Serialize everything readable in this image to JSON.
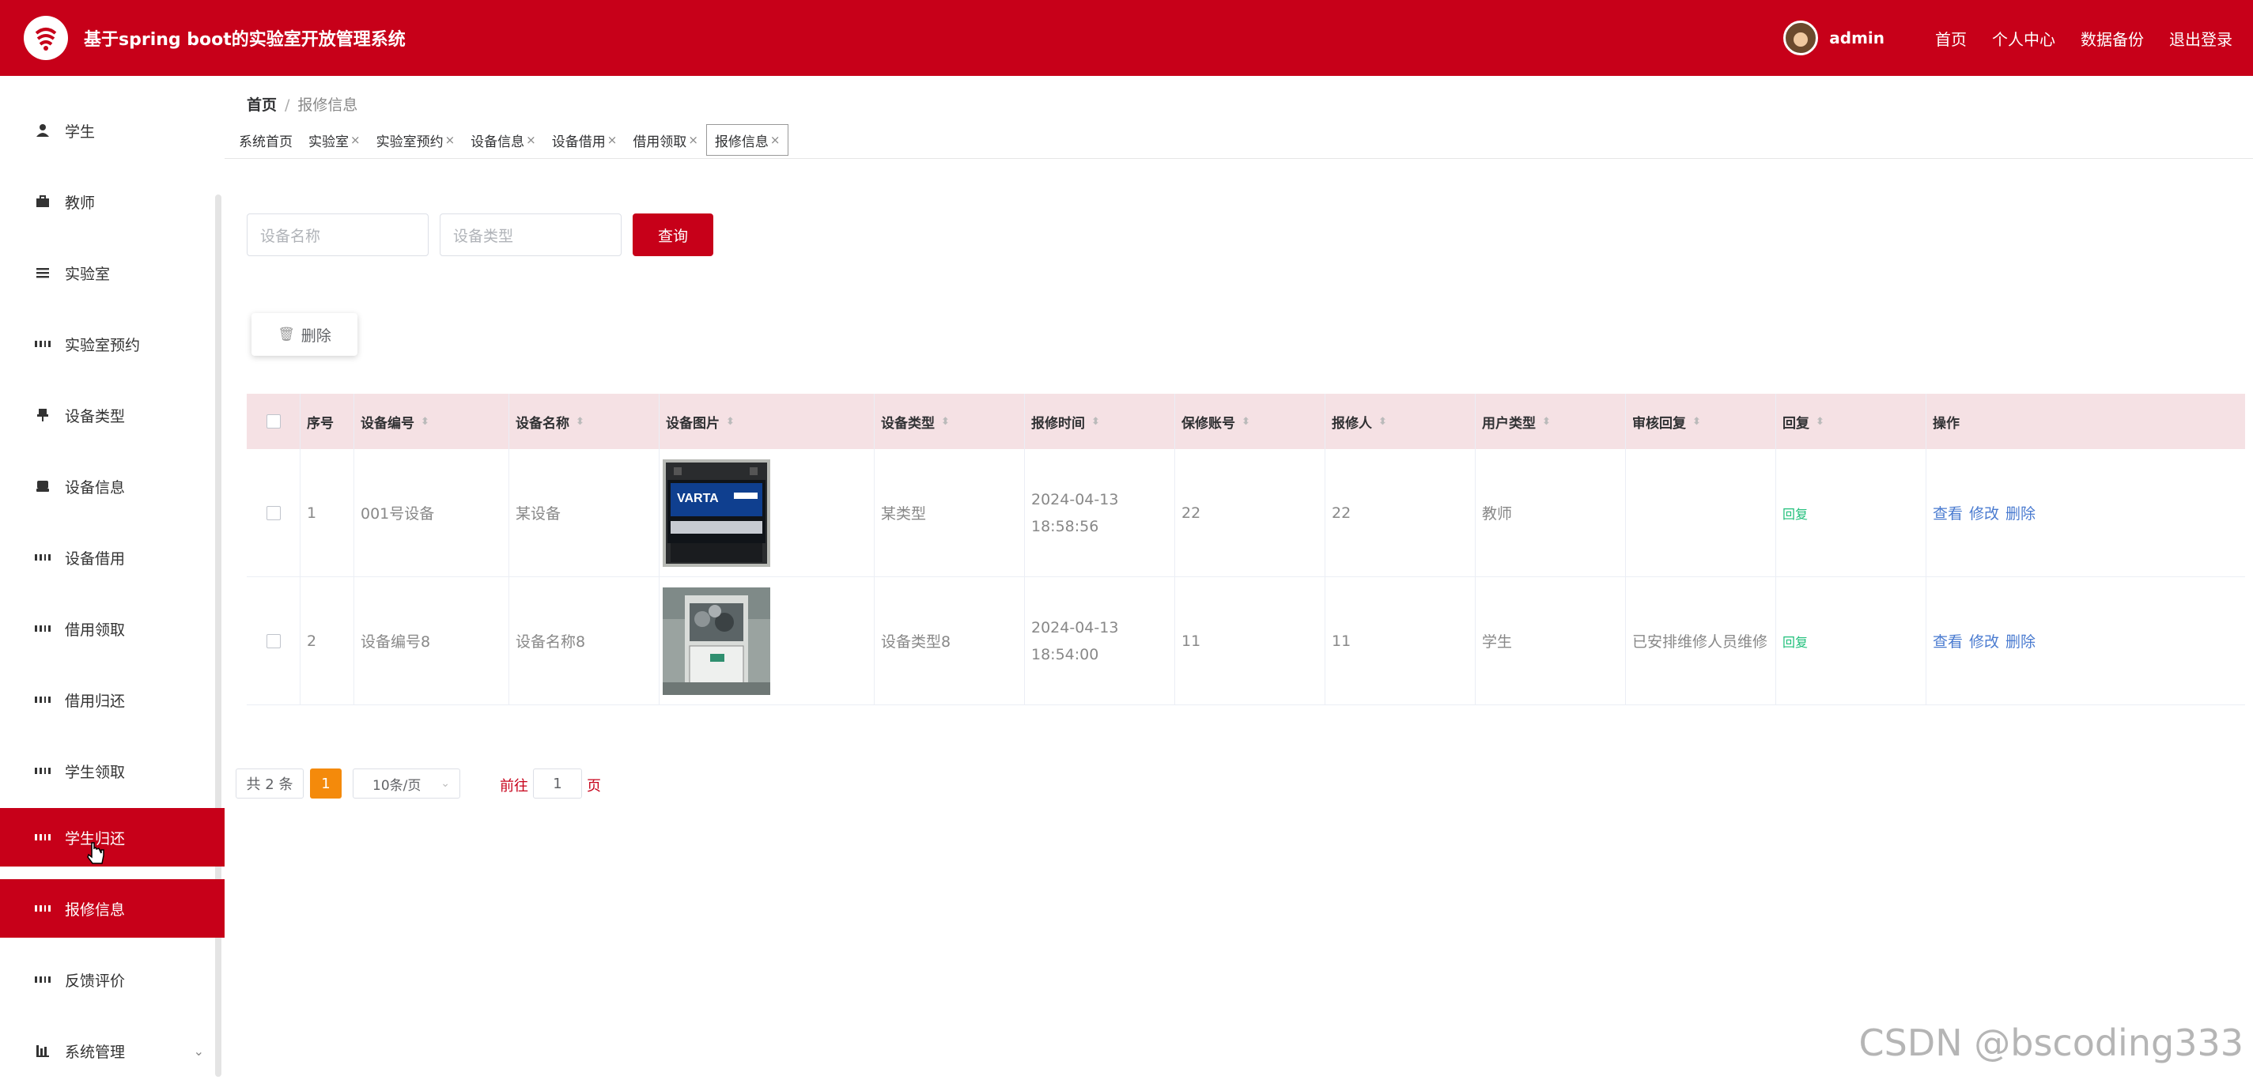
{
  "header": {
    "title": "基于spring boot的实验室开放管理系统",
    "username": "admin",
    "links": [
      "首页",
      "个人中心",
      "数据备份",
      "退出登录"
    ],
    "brand_color": "#c70019"
  },
  "sidebar": {
    "items": [
      {
        "label": "学生",
        "icon": "user-icon"
      },
      {
        "label": "教师",
        "icon": "briefcase-icon"
      },
      {
        "label": "实验室",
        "icon": "list-icon"
      },
      {
        "label": "实验室预约",
        "icon": "grid-icon"
      },
      {
        "label": "设备类型",
        "icon": "pushpin-icon"
      },
      {
        "label": "设备信息",
        "icon": "drive-icon"
      },
      {
        "label": "设备借用",
        "icon": "grid-icon"
      },
      {
        "label": "借用领取",
        "icon": "grid-icon"
      },
      {
        "label": "借用归还",
        "icon": "grid-icon"
      },
      {
        "label": "学生领取",
        "icon": "grid-icon"
      },
      {
        "label": "学生归还",
        "icon": "grid-icon"
      },
      {
        "label": "报修信息",
        "icon": "grid-icon"
      },
      {
        "label": "反馈评价",
        "icon": "grid-icon"
      },
      {
        "label": "系统管理",
        "icon": "bar-chart-icon"
      }
    ]
  },
  "breadcrumb": {
    "home": "首页",
    "sep": "/",
    "current": "报修信息"
  },
  "tabs": [
    {
      "label": "系统首页",
      "closable": false
    },
    {
      "label": "实验室",
      "closable": true
    },
    {
      "label": "实验室预约",
      "closable": true
    },
    {
      "label": "设备信息",
      "closable": true
    },
    {
      "label": "设备借用",
      "closable": true
    },
    {
      "label": "借用领取",
      "closable": true
    },
    {
      "label": "报修信息",
      "closable": true
    }
  ],
  "close_mark": "×",
  "search": {
    "name_placeholder": "设备名称",
    "type_placeholder": "设备类型",
    "query_label": "查询"
  },
  "actions": {
    "delete_label": "删除",
    "delete_icon": "🗑"
  },
  "table": {
    "headers": [
      "序号",
      "设备编号",
      "设备名称",
      "设备图片",
      "设备类型",
      "报修时间",
      "保修账号",
      "报修人",
      "用户类型",
      "审核回复",
      "回复",
      "操作"
    ],
    "rows": [
      {
        "index": "1",
        "code": "001号设备",
        "name": "某设备",
        "image": "battery-photo",
        "type": "某类型",
        "time": "2024-04-13 18:58:56",
        "account": "22",
        "reporter": "22",
        "user_type": "教师",
        "review": "",
        "reply": "回复",
        "ops": [
          "查看",
          "修改",
          "删除"
        ]
      },
      {
        "index": "2",
        "code": "设备编号8",
        "name": "设备名称8",
        "image": "machine-photo",
        "type": "设备类型8",
        "time": "2024-04-13 18:54:00",
        "account": "11",
        "reporter": "11",
        "user_type": "学生",
        "review": "已安排维修人员维修",
        "reply": "回复",
        "ops": [
          "查看",
          "修改",
          "删除"
        ]
      }
    ]
  },
  "pagination": {
    "total": "共 2 条",
    "current": "1",
    "page_size": "10条/页",
    "goto_label": "前往",
    "goto_value": "1",
    "page_label": "页"
  },
  "watermark": "CSDN @bscoding333"
}
